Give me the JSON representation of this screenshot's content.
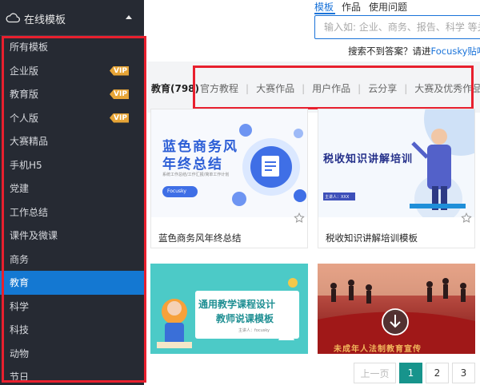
{
  "sidebar": {
    "header": {
      "title": "在线模板",
      "icon": "cloud-icon"
    },
    "items": [
      {
        "label": "所有模板",
        "vip": false
      },
      {
        "label": "企业版",
        "vip": true
      },
      {
        "label": "教育版",
        "vip": true
      },
      {
        "label": "个人版",
        "vip": true
      },
      {
        "label": "大赛精品",
        "vip": false
      },
      {
        "label": "手机H5",
        "vip": false
      },
      {
        "label": "党建",
        "vip": false
      },
      {
        "label": "工作总结",
        "vip": false
      },
      {
        "label": "课件及微课",
        "vip": false
      },
      {
        "label": "商务",
        "vip": false
      },
      {
        "label": "教育",
        "vip": false,
        "active": true
      },
      {
        "label": "科学",
        "vip": false
      },
      {
        "label": "科技",
        "vip": false
      },
      {
        "label": "动物",
        "vip": false
      },
      {
        "label": "节日",
        "vip": false
      }
    ],
    "vip_label": "VIP"
  },
  "search": {
    "tabs": [
      "模板",
      "作品",
      "使用问题"
    ],
    "placeholder": "输入如: 企业、商务、报告、科学 等关键",
    "help_text": "搜索不到答案？请进",
    "help_link": "Focusky贴吧"
  },
  "categories": {
    "current": "教育(798)",
    "tabs": [
      "官方教程",
      "大赛作品",
      "用户作品",
      "云分享",
      "大赛及优秀作品分享"
    ]
  },
  "cards": [
    {
      "name": "蓝色商务风年终总结",
      "thumb_title_1": "蓝色商务风",
      "thumb_title_2": "年终总结",
      "thumb_sub": "系统工作总结/工作汇报/简单工作计划",
      "thumb_btn": "Focusky"
    },
    {
      "name": "税收知识讲解培训模板",
      "thumb_title": "税收知识讲解培训",
      "thumb_presenter": "主讲人：XXX"
    },
    {
      "name": "",
      "thumb_title_1": "通用教学课程设计",
      "thumb_title_2": "教师说课模板",
      "thumb_sub": "主讲人：focusky"
    },
    {
      "name": "",
      "thumb_title": "未成年人法制教育宣传"
    }
  ],
  "pagination": {
    "prev": "上一页",
    "pages": [
      "1",
      "2",
      "3"
    ],
    "current": "1"
  },
  "colors": {
    "sidebar_bg": "#262a33",
    "active_blue": "#1478d2",
    "vip_orange": "#e7a537",
    "accent_blue": "#1a73d9",
    "highlight_red": "#e8202e",
    "pager_teal": "#17948c"
  }
}
